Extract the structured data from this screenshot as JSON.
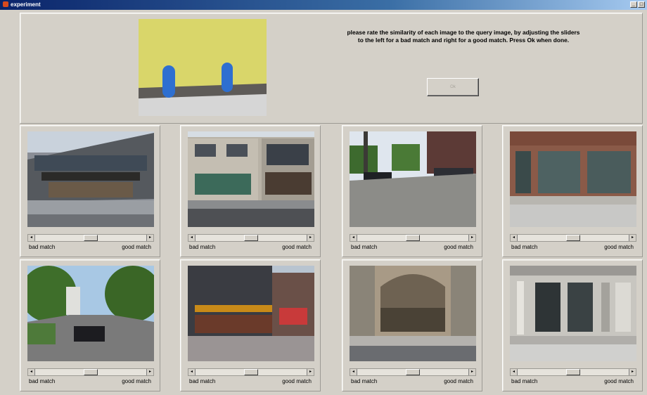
{
  "window": {
    "title": "experiment",
    "minimize": "_",
    "maximize": "□"
  },
  "header": {
    "instructions": "please rate the similarity of each image to the query image, by adjusting the sliders to the left for a bad match and right for a good match. Press Ok when done.",
    "ok_label": "Ok"
  },
  "slider_labels": {
    "left": "bad match",
    "right": "good match"
  },
  "items": [
    {
      "photo_icon": "street-building-photo-icon",
      "rating": 0.5
    },
    {
      "photo_icon": "street-building-photo-icon",
      "rating": 0.5
    },
    {
      "photo_icon": "cobblestone-street-photo-icon",
      "rating": 0.5
    },
    {
      "photo_icon": "brick-building-photo-icon",
      "rating": 0.5
    },
    {
      "photo_icon": "tree-lined-street-photo-icon",
      "rating": 0.5
    },
    {
      "photo_icon": "corner-store-photo-icon",
      "rating": 0.5
    },
    {
      "photo_icon": "arch-facade-photo-icon",
      "rating": 0.5
    },
    {
      "photo_icon": "office-building-photo-icon",
      "rating": 0.5
    }
  ],
  "colors": {
    "query_sky": "#d9d66a",
    "query_blobs": "#2e6fd0",
    "window_bg": "#d4d0c8"
  }
}
